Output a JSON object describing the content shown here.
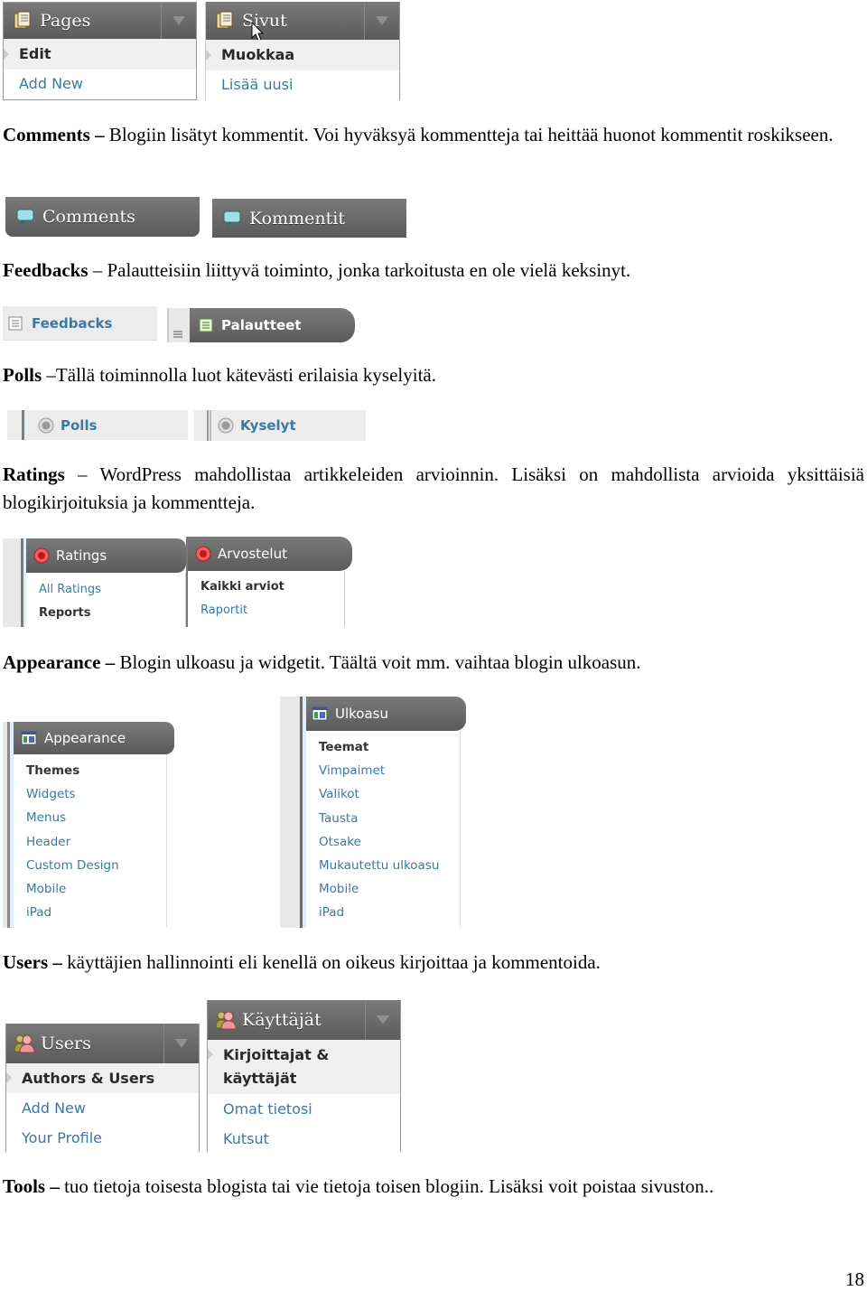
{
  "widgets": {
    "pages_en": {
      "title": "Pages",
      "items": [
        "Edit",
        "Add New"
      ]
    },
    "pages_fi": {
      "title": "Sivut",
      "items": [
        "Muokkaa",
        "Lisää uusi"
      ]
    },
    "comments_en": {
      "title": "Comments"
    },
    "comments_fi": {
      "title": "Kommentit"
    },
    "feedbacks_en": {
      "title": "Feedbacks"
    },
    "feedbacks_fi": {
      "title": "Palautteet"
    },
    "polls_en": {
      "title": "Polls"
    },
    "polls_fi": {
      "title": "Kyselyt"
    },
    "ratings_en": {
      "title": "Ratings",
      "items": [
        "All Ratings",
        "Reports"
      ]
    },
    "ratings_fi": {
      "title": "Arvostelut",
      "items": [
        "Kaikki arviot",
        "Raportit"
      ]
    },
    "appearance_en": {
      "title": "Appearance",
      "items": [
        "Themes",
        "Widgets",
        "Menus",
        "Header",
        "Custom Design",
        "Mobile",
        "iPad"
      ]
    },
    "appearance_fi": {
      "title": "Ulkoasu",
      "items": [
        "Teemat",
        "Vimpaimet",
        "Valikot",
        "Tausta",
        "Otsake",
        "Mukautettu ulkoasu",
        "Mobile",
        "iPad"
      ]
    },
    "users_en": {
      "title": "Users",
      "items": [
        "Authors & Users",
        "Add New",
        "Your Profile"
      ]
    },
    "users_fi": {
      "title": "Käyttäjät",
      "items": [
        "Kirjoittajat &",
        "käyttäjät",
        "Omat tietosi",
        "Kutsut"
      ]
    }
  },
  "paragraphs": {
    "comments": {
      "term": "Comments –",
      "text": " Blogiin lisätyt kommentit. Voi hyväksyä kommentteja tai heittää huonot kommentit roskikseen."
    },
    "feedbacks": {
      "term": "Feedbacks",
      "text": " – Palautteisiin liittyvä toiminto, jonka tarkoitusta en ole vielä keksinyt."
    },
    "polls": {
      "term": "Polls",
      "text": " –Tällä toiminnolla luot kätevästi erilaisia kyselyitä."
    },
    "ratings": {
      "term": "Ratings",
      "text": " – WordPress mahdollistaa artikkeleiden arvioinnin. Lisäksi on mahdollista arvioida yksittäisiä blogikirjoituksia ja kommentteja."
    },
    "appearance": {
      "term": "Appearance –",
      "text": " Blogin ulkoasu ja widgetit. Täältä voit mm. vaihtaa blogin ulkoasun."
    },
    "users": {
      "term": "Users –",
      "text": " käyttäjien hallinnointi eli kenellä on oikeus kirjoittaa ja kommentoida."
    },
    "tools": {
      "term": "Tools –",
      "text": " tuo tietoja toisesta blogista tai vie tietoja toisen blogiin. Lisäksi voit poistaa sivuston.."
    }
  },
  "page_number": "18"
}
